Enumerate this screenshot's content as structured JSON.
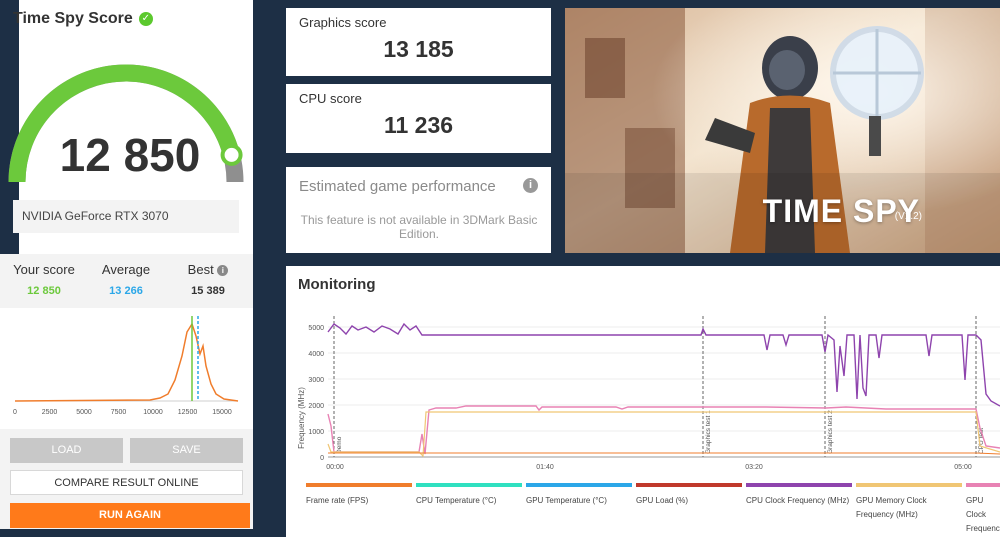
{
  "score_card": {
    "title": "Time Spy Score",
    "score": "12 850",
    "gpu": "NVIDIA GeForce RTX 3070",
    "gauge_fraction": 0.92
  },
  "comparison": {
    "your_score_label": "Your score",
    "your_score_value": "12 850",
    "average_label": "Average",
    "average_value": "13 266",
    "best_label": "Best",
    "best_value": "15 389"
  },
  "distribution": {
    "x_ticks": [
      "0",
      "2500",
      "5000",
      "7500",
      "10000",
      "12500",
      "15000"
    ]
  },
  "buttons": {
    "load": "LOAD",
    "save": "SAVE",
    "compare": "COMPARE RESULT ONLINE",
    "run_again": "RUN AGAIN"
  },
  "graphics": {
    "label": "Graphics score",
    "value": "13 185"
  },
  "cpu": {
    "label": "CPU score",
    "value": "11 236"
  },
  "estimated": {
    "title": "Estimated game performance",
    "text": "This feature is not available in 3DMark Basic Edition."
  },
  "banner": {
    "title": "TIME SPY",
    "version": "(V1.2)"
  },
  "monitoring": {
    "title": "Monitoring",
    "y_axis_label": "Frequency (MHz)",
    "y_ticks": [
      "5000",
      "4000",
      "3000",
      "2000",
      "1000",
      "0"
    ],
    "x_ticks": [
      "00:00",
      "01:40",
      "03:20",
      "05:00"
    ],
    "markers": [
      "Demo",
      "Graphics test 1",
      "Graphics test 2",
      "CPU test"
    ],
    "legend": [
      {
        "label": "Frame rate (FPS)",
        "color": "#f07d2c"
      },
      {
        "label": "CPU Temperature (°C)",
        "color": "#2fe0c0"
      },
      {
        "label": "GPU Temperature (°C)",
        "color": "#2ba7e8"
      },
      {
        "label": "GPU Load (%)",
        "color": "#c0392b"
      },
      {
        "label": "CPU Clock Frequency (MHz)",
        "color": "#8e44ad"
      },
      {
        "label": "GPU Memory Clock Frequency (MHz)",
        "color": "#f0c674"
      },
      {
        "label": "GPU Clock Frequency",
        "color": "#e882b4"
      }
    ]
  },
  "colors": {
    "accent_green": "#6cc93c",
    "accent_blue": "#2ba7e8",
    "orange": "#ff7a1a"
  }
}
